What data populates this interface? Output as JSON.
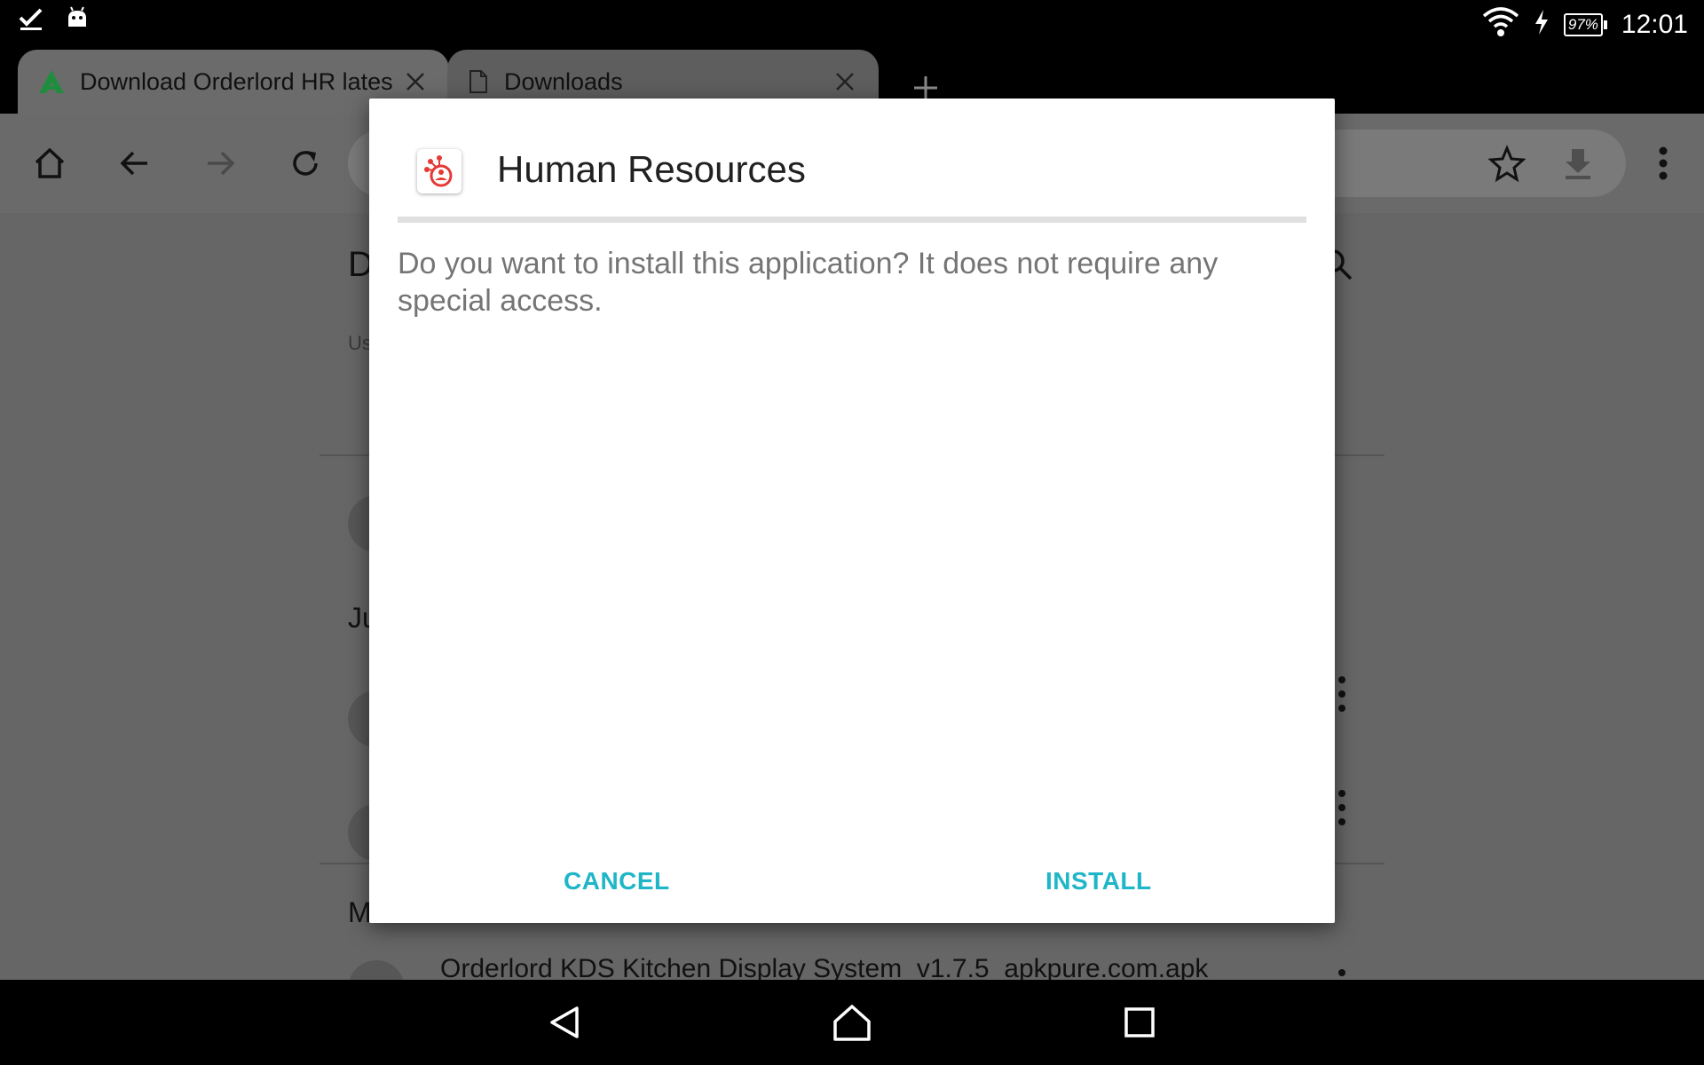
{
  "status_bar": {
    "notification_icons": [
      "checkmark-icon",
      "android-icon"
    ],
    "battery_percent": "97%",
    "clock": "12:01"
  },
  "tabs": [
    {
      "title": "Download Orderlord HR lates",
      "icon": "apkpure-icon",
      "active": true
    },
    {
      "title": "Downloads",
      "icon": "document-icon",
      "active": false
    }
  ],
  "page": {
    "heading_partial": "D",
    "subtext_partial": "Us",
    "section_label_partial": "Ju",
    "section2_label_partial": "M",
    "file_row_title": "Orderlord KDS Kitchen Display System_v1.7.5_apkpure.com.apk"
  },
  "dialog": {
    "app_name": "Human Resources",
    "message": "Do you want to install this application? It does not require any special access.",
    "cancel_label": "CANCEL",
    "install_label": "INSTALL",
    "accent_color": "#1fb6c7",
    "app_icon_color": "#e53935"
  }
}
